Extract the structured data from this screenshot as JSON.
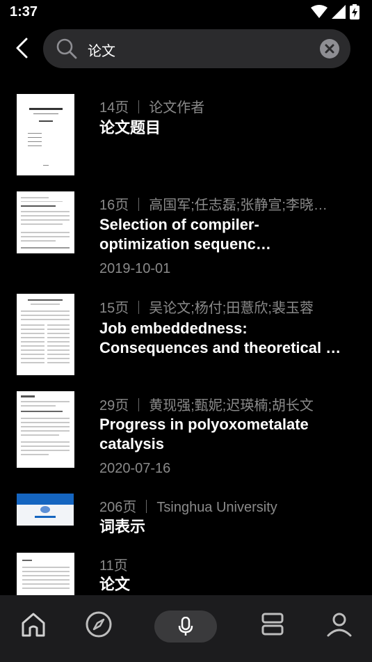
{
  "status": {
    "time": "1:37"
  },
  "search": {
    "value": "论文",
    "placeholder": ""
  },
  "results": [
    {
      "pages": "14页",
      "author": "论文作者",
      "title": "论文题目",
      "date": ""
    },
    {
      "pages": "16页",
      "author": "高国军;任志磊;张静宣;李晓…",
      "title": "Selection of compiler-optimization sequenc…",
      "date": "2019-10-01"
    },
    {
      "pages": "15页",
      "author": "吴论文;杨付;田薏欣;裴玉蓉",
      "title": "Job embeddedness: Consequences and theoretical …",
      "date": ""
    },
    {
      "pages": "29页",
      "author": "黄现强;甄妮;迟瑛楠;胡长文",
      "title": "Progress in polyoxometalate catalysis",
      "date": "2020-07-16"
    },
    {
      "pages": "206页",
      "author": "Tsinghua University",
      "title": "词表示",
      "date": ""
    },
    {
      "pages": "11页",
      "author": "",
      "title": "论文",
      "date": ""
    }
  ],
  "nav": {
    "items": [
      "home-icon",
      "compass-icon",
      "mic-icon",
      "library-icon",
      "profile-icon"
    ]
  },
  "colors": {
    "background": "#000000",
    "search_bg": "#2b2b2d",
    "meta": "#8a8a8a",
    "nav_bg": "#1c1c1e",
    "accent_blue": "#1565c0"
  }
}
